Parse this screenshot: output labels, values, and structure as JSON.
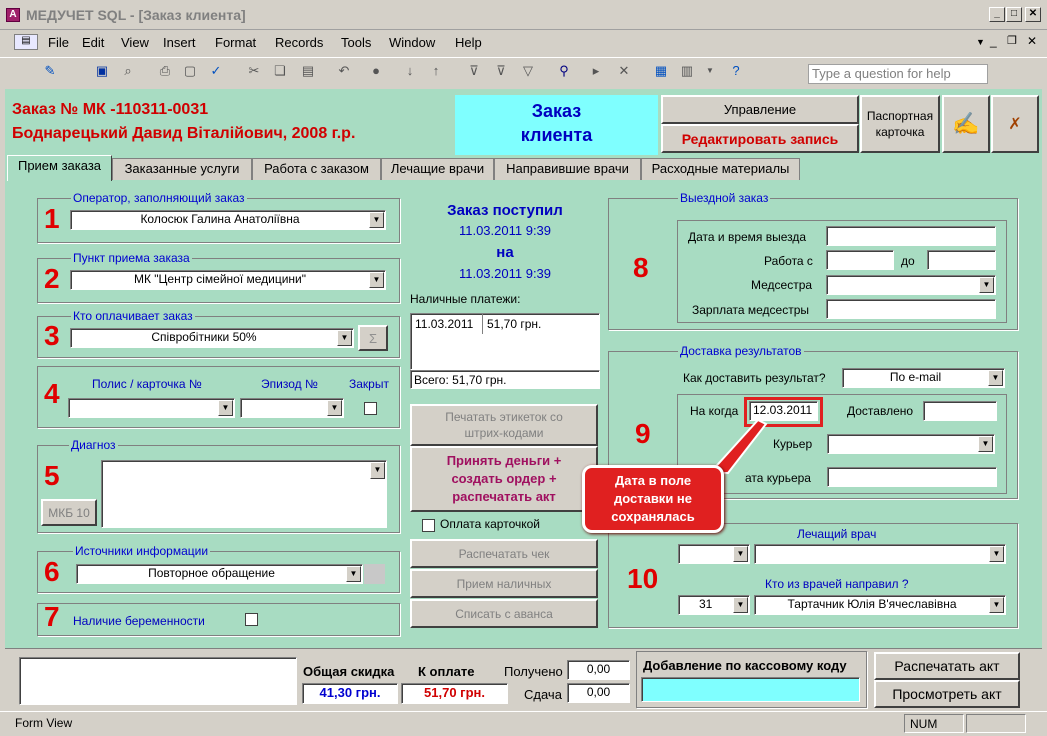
{
  "window": {
    "title": "МЕДУЧЕТ SQL - [Заказ клиента]",
    "icon": "access-form-icon"
  },
  "menu": {
    "items": [
      "File",
      "Edit",
      "View",
      "Insert",
      "Format",
      "Records",
      "Tools",
      "Window",
      "Help"
    ],
    "help_placeholder": "Type a question for help"
  },
  "header": {
    "order_no": "Заказ № МК -110311-0031",
    "patient": "Боднарецький Давид Віталійович, 2008 г.р.",
    "form_title_1": "Заказ",
    "form_title_2": "клиента",
    "manage_btn": "Управление",
    "edit_btn": "Редактировать запись",
    "passport_btn": "Паспортная карточка"
  },
  "tabs": [
    "Прием заказа",
    "Заказанные услуги",
    "Работа с заказом",
    "Лечащие врачи",
    "Направившие врачи",
    "Расходные материалы"
  ],
  "left": {
    "operator_label": "Оператор, заполняющий заказ",
    "operator_value": "Колосюк Галина Анатоліївна",
    "point_label": "Пункт приема заказа",
    "point_value": "МК \"Центр сімейної медицини\"",
    "payer_label": "Кто оплачивает заказ",
    "payer_value": "Співробітники 50%",
    "sigma": "Σ",
    "policy_label": "Полис / карточка №",
    "episode_label": "Эпизод №",
    "closed_label": "Закрыт",
    "diagnosis_label": "Диагноз",
    "mkb_btn": "МКБ 10",
    "sources_label": "Источники информации",
    "sources_value": "Повторное обращение",
    "pregnancy_label": "Наличие беременности"
  },
  "numbers": [
    "1",
    "2",
    "3",
    "4",
    "5",
    "6",
    "7",
    "8",
    "9",
    "10"
  ],
  "middle": {
    "received_title": "Заказ поступил",
    "received_date": "11.03.2011 9:39",
    "on_label": "на",
    "on_date": "11.03.2011 9:39",
    "cash_label": "Наличные платежи:",
    "payment_date": "11.03.2011",
    "payment_amount": "51,70 грн.",
    "total": "Всего: 51,70 грн.",
    "print_labels_btn": "Печатать этикеток со штрих-кодами",
    "accept_btn": "Принять деньги + создать ордер + распечатать акт",
    "card_pay_label": "Оплата карточкой",
    "print_check_btn": "Распечатать чек",
    "cash_accept_btn": "Прием наличных",
    "advance_btn": "Списать с аванса"
  },
  "right": {
    "visit_label": "Выездной заказ",
    "visit_datetime_label": "Дата и время выезда",
    "work_from_label": "Работа с",
    "to_label": "до",
    "nurse_label": "Медсестра",
    "nurse_salary_label": "Зарплата медсестры",
    "delivery_label": "Доставка результатов",
    "how_label": "Как доставить результат?",
    "how_value": "По e-mail",
    "when_label": "На когда",
    "when_value": "12.03.2011",
    "delivered_label": "Доставлено",
    "courier_label": "Курьер",
    "courier_salary_label": "ата курьера",
    "doctor_label": "Лечащий врач",
    "referrer_label": "Кто из врачей направил ?",
    "referrer_num": "31",
    "referrer_value": "Тартачник Юлія В'ячеславівна"
  },
  "callout": "Дата в поле доставки не сохранялась",
  "footer": {
    "discount_label": "Общая скидка",
    "discount_value": "41,30 грн.",
    "topay_label": "К оплате",
    "topay_value": "51,70 грн.",
    "received_label": "Получено",
    "received_value": "0,00",
    "change_label": "Сдача",
    "change_value": "0,00",
    "cash_code_label": "Добавление по кассовому коду",
    "print_act_btn": "Распечатать акт",
    "view_act_btn": "Просмотреть акт"
  },
  "status": {
    "mode": "Form View",
    "num": "NUM"
  }
}
